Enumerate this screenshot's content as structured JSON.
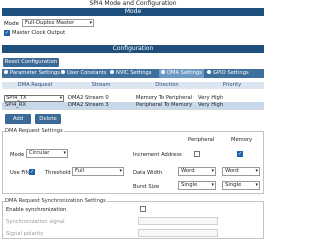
{
  "window_title": "SPI4 Mode and Configuration",
  "mode_section": "Mode",
  "mode": {
    "label": "Mode",
    "value": "Full-Duplex Master"
  },
  "master_clock": {
    "label": "Master Clock Output",
    "checked": true
  },
  "config_section": "Configuration",
  "reset_button": "Reset Configuration",
  "tabs": [
    {
      "label": "Parameter Settings"
    },
    {
      "label": "User Constants"
    },
    {
      "label": "NVIC Settings"
    },
    {
      "label": "DMA Settings",
      "active": true
    },
    {
      "label": "GPIO Settings"
    }
  ],
  "dma_table": {
    "headers": [
      "DMA Request",
      "Stream",
      "Direction",
      "Priority"
    ],
    "rows": [
      {
        "request": "SPI4_TX",
        "stream": "DMA2 Stream 0",
        "direction": "Memory To Peripheral",
        "priority": "Very High"
      },
      {
        "request": "SPI4_RX",
        "stream": "DMA2 Stream 3",
        "direction": "Peripheral To Memory",
        "priority": "Very High"
      }
    ]
  },
  "add_button": "Add",
  "delete_button": "Delete",
  "request_settings": {
    "title": "DMA Request Settings",
    "peripheral_header": "Peripheral",
    "memory_header": "Memory",
    "mode_label": "Mode",
    "mode_value": "Circular",
    "increment_label": "Increment Address",
    "increment_peripheral": false,
    "increment_memory": true,
    "use_fifo_label": "Use Fifo",
    "use_fifo": true,
    "threshold_label": "Threshold",
    "threshold_value": "Full",
    "data_width_label": "Data Width",
    "data_width_peripheral": "Word",
    "data_width_memory": "Word",
    "burst_size_label": "Burst Size",
    "burst_size_peripheral": "Single",
    "burst_size_memory": "Single"
  },
  "sync_settings": {
    "title": "DMA Request Synchronization Settings",
    "enable_label": "Enable synchronization",
    "enabled": false,
    "signal_label": "Synchronization signal",
    "polarity_label": "Signal polarity"
  },
  "colors": {
    "section_bar": "#1e4f7d",
    "tab_bar": "#3f6f9c",
    "active_tab": "#6d98c2",
    "button": "#3c6a97",
    "selected_row": "#c9d9ec"
  }
}
